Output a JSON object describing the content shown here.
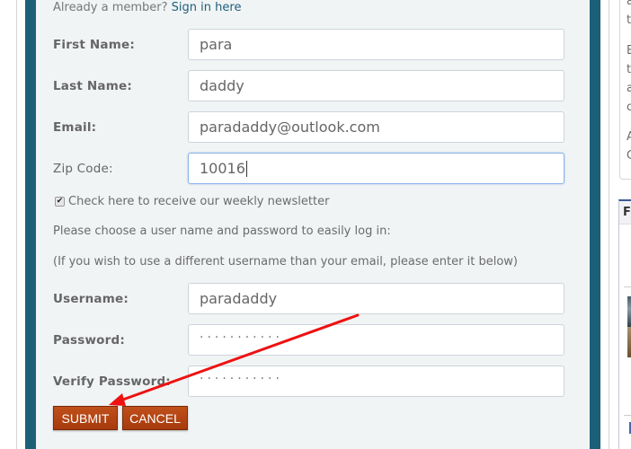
{
  "form": {
    "already_member_text": "Already a member?",
    "sign_in_link": "Sign in here",
    "fields": [
      {
        "label": "First Name:",
        "value": "para"
      },
      {
        "label": "Last Name:",
        "value": "daddy"
      },
      {
        "label": "Email:",
        "value": "paradaddy@outlook.com"
      },
      {
        "label": "Zip Code:",
        "value": "10016"
      }
    ],
    "newsletter": {
      "label": "Check here to receive our weekly newsletter",
      "checked": true
    },
    "info_line_1": "Please choose a user name and password to easily log in:",
    "info_line_2": "(If you wish to use a different username than your email, please enter it below)",
    "username": {
      "label": "Username:",
      "value": "paradaddy"
    },
    "password": {
      "label": "Password:",
      "masked_value": "···········"
    },
    "verify_password": {
      "label": "Verify Password:",
      "masked_value": "···········"
    },
    "submit_label": "SUBMIT",
    "cancel_label": "CANCEL"
  },
  "sidebar": {
    "text_fragments": [
      "a",
      "t",
      "E",
      "t",
      "a",
      "c",
      "A",
      "C"
    ],
    "widget_header": "F"
  },
  "annotation": {
    "type": "arrow",
    "color": "#ee1111",
    "points_to": "submit-button"
  },
  "colors": {
    "frame_teal": "#1c5f78",
    "panel_bg": "#f1f4f5",
    "button_orange": "#b5451a",
    "link": "#1e5f79"
  }
}
